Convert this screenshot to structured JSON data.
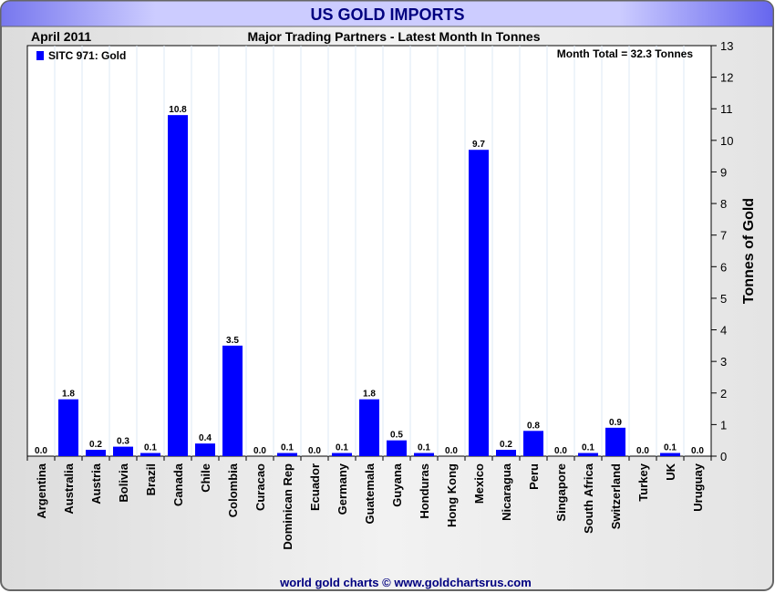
{
  "chart_data": {
    "type": "bar",
    "title": "US GOLD IMPORTS",
    "subtitle": "Major Trading Partners - Latest Month In Tonnes",
    "period": "April 2011",
    "annotation": "Month Total = 32.3 Tonnes",
    "legend": {
      "label": "SITC 971: Gold",
      "position": "top-left"
    },
    "ylabel": "Tonnes of Gold",
    "xlabel": "",
    "ylim": [
      0,
      13
    ],
    "yticks": [
      0,
      1,
      2,
      3,
      4,
      5,
      6,
      7,
      8,
      9,
      10,
      11,
      12,
      13
    ],
    "grid": true,
    "categories": [
      "Argentina",
      "Australia",
      "Austria",
      "Bolivia",
      "Brazil",
      "Canada",
      "Chile",
      "Colombia",
      "Curacao",
      "Dominican Rep",
      "Ecuador",
      "Germany",
      "Guatemala",
      "Guyana",
      "Honduras",
      "Hong Kong",
      "Mexico",
      "Nicaragua",
      "Peru",
      "Singapore",
      "South Africa",
      "Switzerland",
      "Turkey",
      "UK",
      "Uruguay"
    ],
    "values": [
      0.0,
      1.8,
      0.2,
      0.3,
      0.1,
      10.8,
      0.4,
      3.5,
      0.0,
      0.1,
      0.0,
      0.1,
      1.8,
      0.5,
      0.1,
      0.0,
      9.7,
      0.2,
      0.8,
      0.0,
      0.1,
      0.9,
      0.0,
      0.1,
      0.0
    ],
    "footer": "world gold charts © www.goldchartsrus.com"
  },
  "colors": {
    "bar": "#0000ff",
    "title": "#000080",
    "footer": "#000080"
  }
}
